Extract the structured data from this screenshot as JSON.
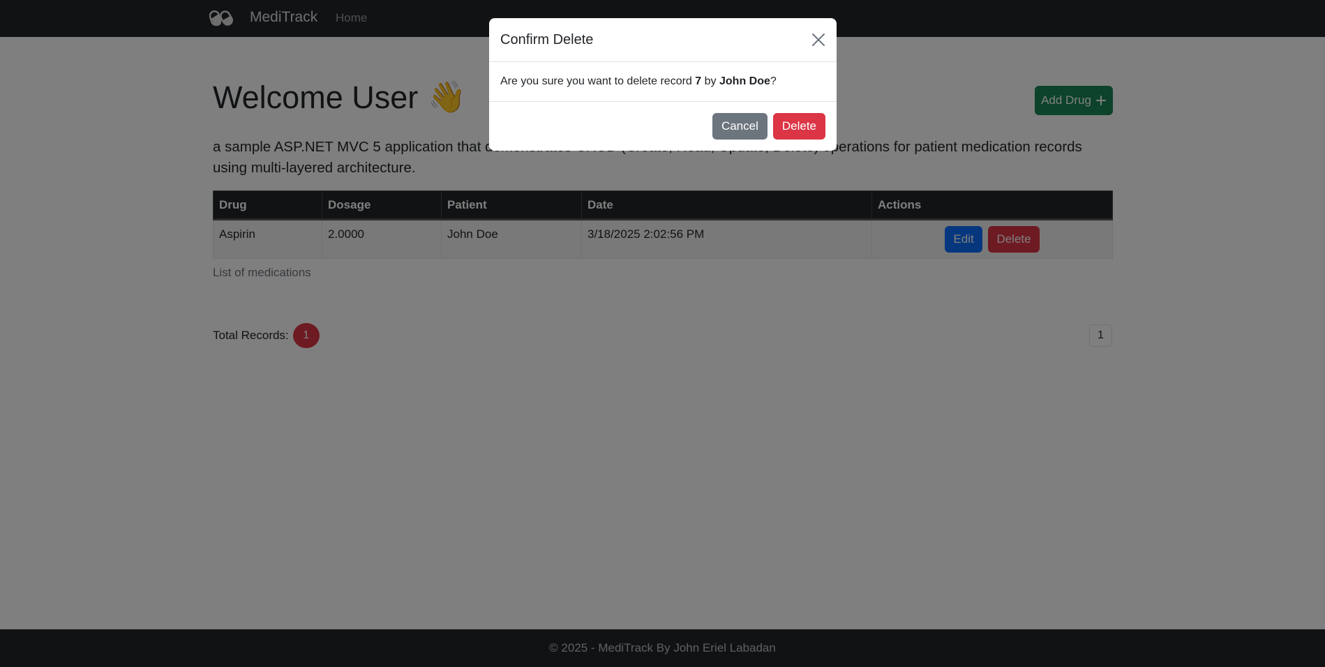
{
  "navbar": {
    "brand": "MediTrack",
    "links": [
      {
        "label": "Home"
      }
    ]
  },
  "main": {
    "heading": "Welcome User",
    "heading_emoji": "👋",
    "add_button_label": "Add Drug",
    "add_button_icon": "plus-icon",
    "lead": "a sample ASP.NET MVC 5 application that demonstrates CRUD (Create, Read, Update, Delete) operations for patient medication records using multi-layered architecture.",
    "table": {
      "headers": [
        "Drug",
        "Dosage",
        "Patient",
        "Date",
        "Actions"
      ],
      "rows": [
        {
          "drug": "Aspirin",
          "dosage": "2.0000",
          "patient": "John Doe",
          "date": "3/18/2025 2:02:56 PM",
          "edit_label": "Edit",
          "delete_label": "Delete"
        }
      ],
      "caption": "List of medications"
    },
    "total_label": "Total Records:",
    "total_count": "1",
    "pagination": [
      "1"
    ]
  },
  "footer": {
    "text": "© 2025 - MediTrack By John Eriel Labadan"
  },
  "modal": {
    "title": "Confirm Delete",
    "body_prefix": "Are you sure you want to delete record",
    "record_id": "7",
    "body_by": "by",
    "record_owner": "John Doe",
    "body_suffix": "?",
    "cancel_label": "Cancel",
    "delete_label": "Delete"
  },
  "colors": {
    "navbar": "#212529",
    "success": "#198754",
    "primary": "#0d6efd",
    "danger": "#dc3545",
    "secondary": "#6c757d"
  }
}
